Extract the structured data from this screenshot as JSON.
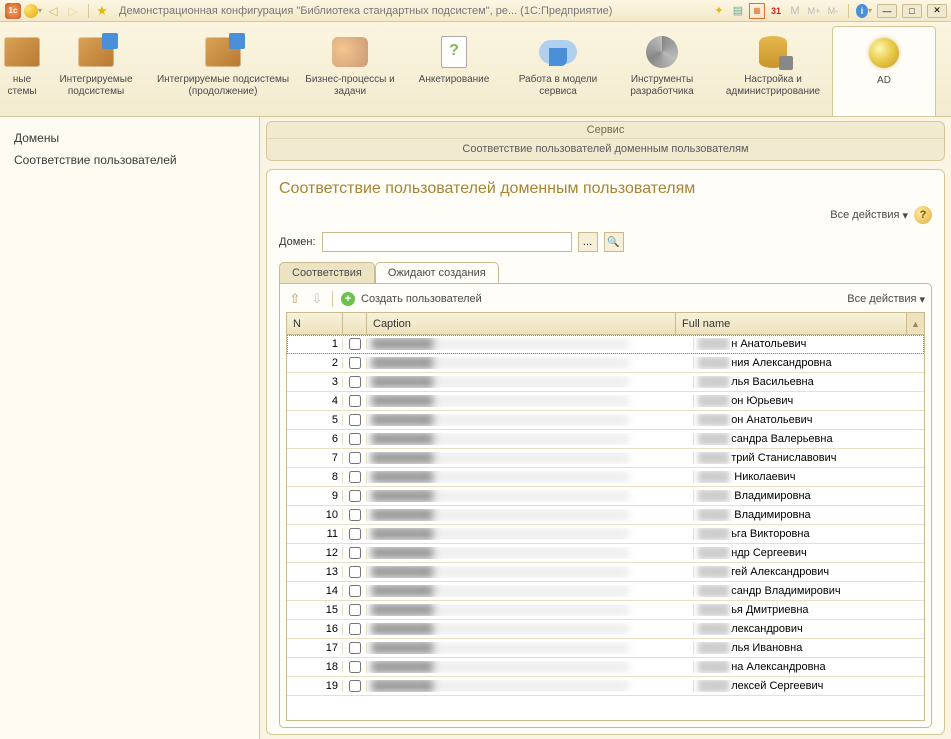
{
  "titlebar": {
    "title": "Демонстрационная конфигурация \"Библиотека стандартных подсистем\", ре...  (1С:Предприятие)"
  },
  "sections": [
    {
      "label": "ные\nстемы"
    },
    {
      "label": "Интегрируемые\nподсистемы"
    },
    {
      "label": "Интегрируемые\nподсистемы (продолжение)"
    },
    {
      "label": "Бизнес-процессы\nи задачи"
    },
    {
      "label": "Анкетирование"
    },
    {
      "label": "Работа в\nмодели сервиса"
    },
    {
      "label": "Инструменты\nразработчика"
    },
    {
      "label": "Настройка и\nадминистрирование"
    },
    {
      "label": "AD"
    }
  ],
  "sidebar": {
    "items": [
      "Домены",
      "Соответствие пользователей"
    ]
  },
  "service_panel": {
    "header": "Сервис",
    "link": "Соответствие пользователей доменным пользователям"
  },
  "page": {
    "title": "Соответствие пользователей доменным пользователям",
    "all_actions": "Все действия",
    "domain_label": "Домен:",
    "domain_value": ""
  },
  "tabs": [
    {
      "label": "Соответствия",
      "active": false
    },
    {
      "label": "Ожидают создания",
      "active": true
    }
  ],
  "tab_toolbar": {
    "create_users": "Создать пользователей",
    "all_actions": "Все действия"
  },
  "table": {
    "columns": {
      "n": "N",
      "caption": "Caption",
      "full_name": "Full name"
    },
    "rows": [
      {
        "n": 1,
        "full": "н Анатольевич"
      },
      {
        "n": 2,
        "full": "ния Александровна"
      },
      {
        "n": 3,
        "full": "лья Васильевна"
      },
      {
        "n": 4,
        "full": "он Юрьевич"
      },
      {
        "n": 5,
        "full": "он Анатольевич"
      },
      {
        "n": 6,
        "full": "сандра Валерьевна"
      },
      {
        "n": 7,
        "full": "трий Станиславович"
      },
      {
        "n": 8,
        "full": " Николаевич"
      },
      {
        "n": 9,
        "full": " Владимировна"
      },
      {
        "n": 10,
        "full": " Владимировна"
      },
      {
        "n": 11,
        "full": "ьга Викторовна"
      },
      {
        "n": 12,
        "full": "ндр Сергеевич"
      },
      {
        "n": 13,
        "full": "гей Александрович"
      },
      {
        "n": 14,
        "full": "сандр Владимирович"
      },
      {
        "n": 15,
        "full": "ья Дмитриевна"
      },
      {
        "n": 16,
        "full": "лександрович"
      },
      {
        "n": 17,
        "full": "лья Ивановна"
      },
      {
        "n": 18,
        "full": "на Александровна"
      },
      {
        "n": 19,
        "full": "лексей Сергеевич"
      }
    ]
  }
}
